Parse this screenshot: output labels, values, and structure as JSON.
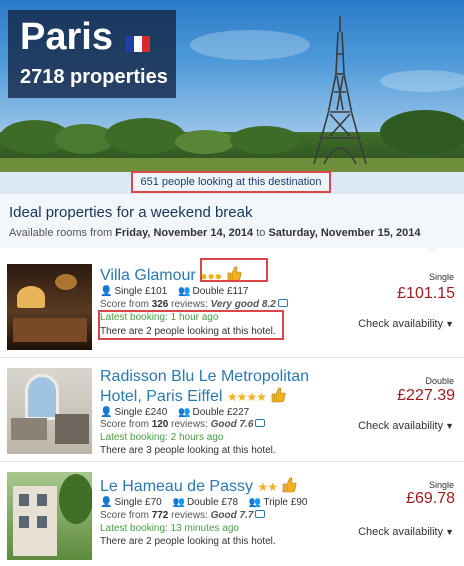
{
  "hero": {
    "city": "Paris",
    "properties": "2718 properties",
    "flag_colors": [
      "#1d3fa6",
      "#ffffff",
      "#d92a2a"
    ]
  },
  "banner": {
    "looking": "651 people looking at this destination"
  },
  "section": {
    "title": "Ideal properties for a weekend break",
    "sub_prefix": "Available rooms from ",
    "date_from": "Friday, November 14, 2014",
    "sub_mid": " to ",
    "date_to": "Saturday, November 15, 2014"
  },
  "hotels": [
    {
      "name": "Villa Glamour",
      "rating_icons": "dots",
      "rating_count": 3,
      "rooms": [
        {
          "icon": "single-person-icon",
          "text": "Single £101"
        },
        {
          "icon": "double-person-icon",
          "text": "Double £117"
        }
      ],
      "score_prefix": "Score from ",
      "review_count": "326",
      "score_mid": " reviews: ",
      "score_text": "Very good 8.2",
      "latest": "Latest booking: 1 hour ago",
      "people": "There are 2 people looking at this hotel.",
      "room_type": "Single",
      "price": "£101.15",
      "cta": "Check availability"
    },
    {
      "name_line1": "Radisson Blu Le Metropolitan",
      "name_line2": "Hotel, Paris Eiffel",
      "rating_icons": "stars",
      "rating_count": 4,
      "rooms": [
        {
          "icon": "single-person-icon",
          "text": "Single £240"
        },
        {
          "icon": "double-person-icon",
          "text": "Double £227"
        }
      ],
      "score_prefix": "Score from ",
      "review_count": "120",
      "score_mid": " reviews: ",
      "score_text": "Good 7.6",
      "latest": "Latest booking: 2 hours ago",
      "people": "There are 3 people looking at this hotel.",
      "room_type": "Double",
      "price": "£227.39",
      "cta": "Check availability"
    },
    {
      "name": "Le Hameau de Passy",
      "rating_icons": "stars",
      "rating_count": 2,
      "rooms": [
        {
          "icon": "single-person-icon",
          "text": "Single £70"
        },
        {
          "icon": "double-person-icon",
          "text": "Double £78"
        },
        {
          "icon": "triple-person-icon",
          "text": "Triple £90"
        }
      ],
      "score_prefix": "Score from ",
      "review_count": "772",
      "score_mid": " reviews: ",
      "score_text": "Good 7.7",
      "latest": "Latest booking: 13 minutes ago",
      "people": "There are 2 people looking at this hotel.",
      "room_type": "Single",
      "price": "£69.78",
      "cta": "Check availability"
    }
  ]
}
